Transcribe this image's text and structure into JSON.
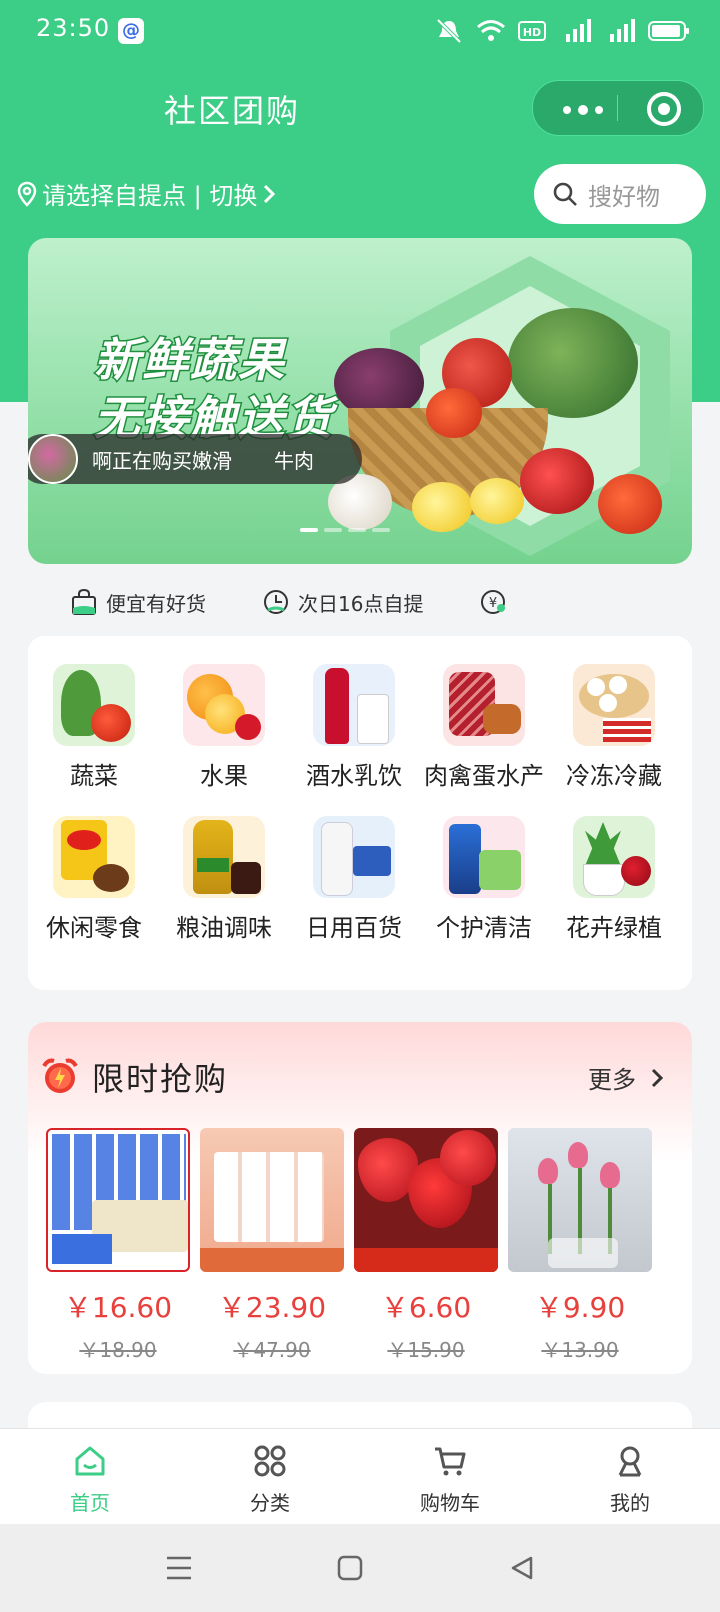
{
  "status_bar": {
    "time": "23:50"
  },
  "header": {
    "title": "社区团购",
    "pickup_label": "请选择自提点 | 切换",
    "search_placeholder": "搜好物"
  },
  "banner": {
    "headline_1": "新鲜蔬果",
    "headline_2": "无接触送货",
    "ticker_text": "啊正在购买嫩滑",
    "ticker_item": "牛肉"
  },
  "features": [
    {
      "label": "便宜有好货"
    },
    {
      "label": "次日16点自提"
    }
  ],
  "categories": [
    {
      "label": "蔬菜"
    },
    {
      "label": "水果"
    },
    {
      "label": "酒水乳饮"
    },
    {
      "label": "肉禽蛋水产"
    },
    {
      "label": "冷冻冷藏"
    },
    {
      "label": "休闲零食"
    },
    {
      "label": "粮油调味"
    },
    {
      "label": "日用百货"
    },
    {
      "label": "个护清洁"
    },
    {
      "label": "花卉绿植"
    }
  ],
  "flash_sale": {
    "title": "限时抢购",
    "more": "更多",
    "products": [
      {
        "price": "￥16.60",
        "original": "￥18.90"
      },
      {
        "price": "￥23.90",
        "original": "￥47.90"
      },
      {
        "price": "￥6.60",
        "original": "￥15.90"
      },
      {
        "price": "￥9.90",
        "original": "￥13.90"
      }
    ]
  },
  "tabbar": [
    {
      "label": "首页",
      "active": true
    },
    {
      "label": "分类"
    },
    {
      "label": "购物车"
    },
    {
      "label": "我的"
    }
  ],
  "colors": {
    "primary": "#3ccd87",
    "price": "#e8403c"
  }
}
